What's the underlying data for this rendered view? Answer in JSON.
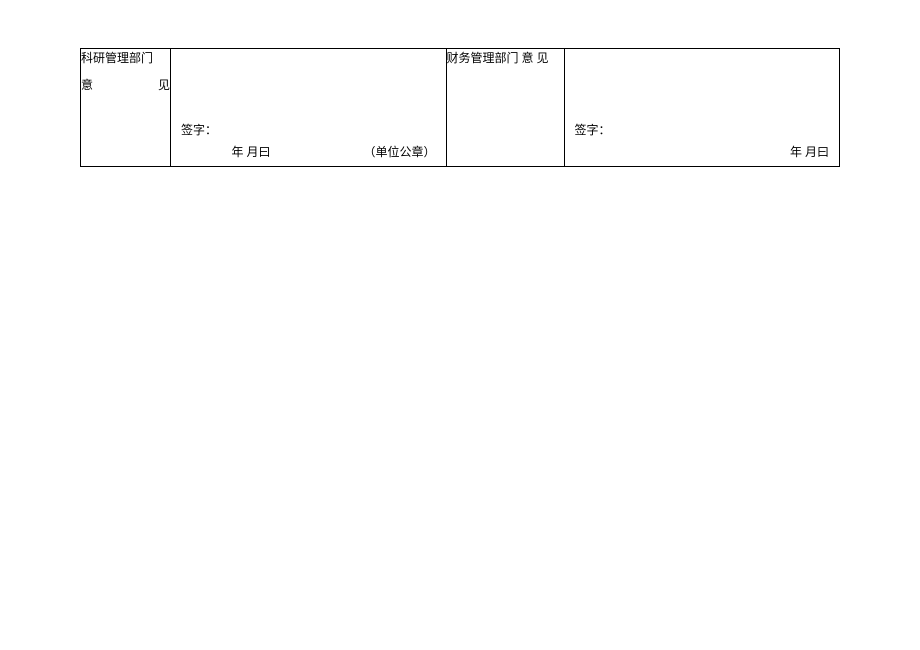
{
  "form": {
    "left": {
      "header_line1": "科研管理部门",
      "header_line2": "意　　　见",
      "sign_label": "签字：",
      "date_text": "年 月曰",
      "seal_text": "（单位公章）"
    },
    "right": {
      "header_text": "财务管理部门 意 见",
      "sign_label": "签字：",
      "date_text": "年 月曰"
    }
  }
}
